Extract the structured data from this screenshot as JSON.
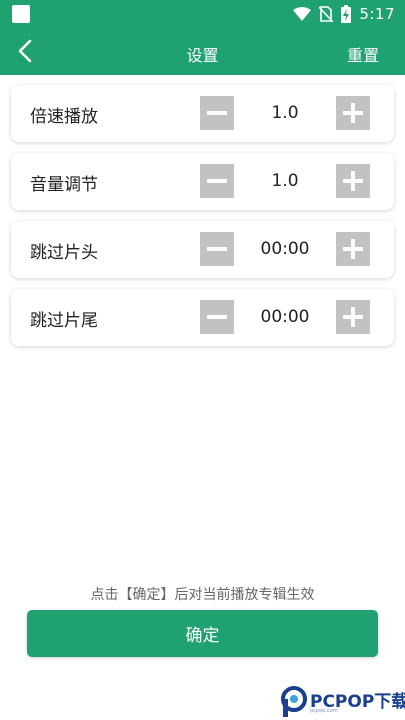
{
  "status_bar": {
    "time": "5:17",
    "icons": [
      "wifi-icon",
      "no-sim-icon",
      "battery-charging-icon"
    ]
  },
  "app_bar": {
    "title": "设置",
    "back_icon": "chevron-left-icon",
    "reset_label": "重置"
  },
  "settings": [
    {
      "label": "倍速播放",
      "value": "1.0"
    },
    {
      "label": "音量调节",
      "value": "1.0"
    },
    {
      "label": "跳过片头",
      "value": "00:00"
    },
    {
      "label": "跳过片尾",
      "value": "00:00"
    }
  ],
  "hint": "点击【确定】后对当前播放专辑生效",
  "confirm_label": "确定",
  "watermark": {
    "text": "PCPOP下载",
    "small": "pcpop.com"
  },
  "colors": {
    "accent": "#20a172",
    "stepper": "#c2c2c2",
    "watermark": "#1a3f8f"
  }
}
